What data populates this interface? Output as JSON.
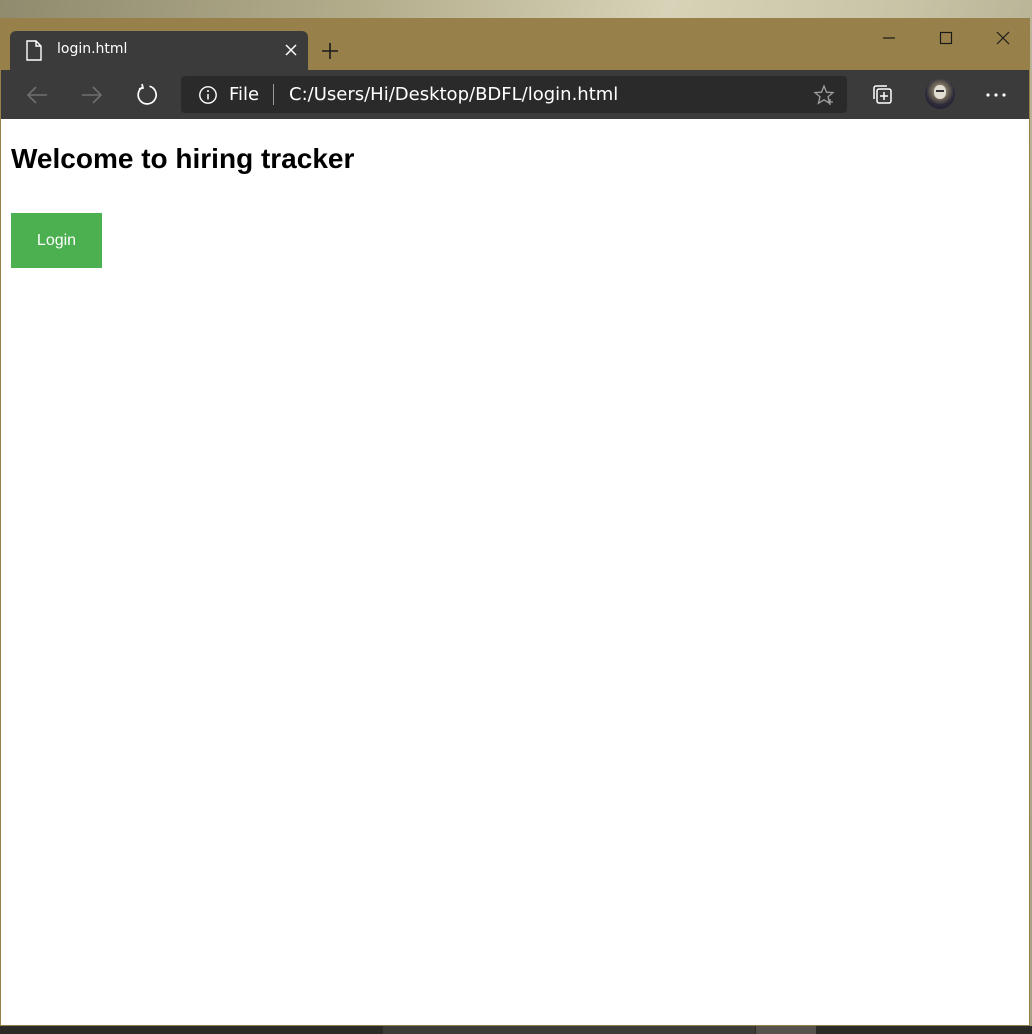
{
  "browser": {
    "tab": {
      "title": "login.html",
      "icon": "page-icon",
      "close_icon": "close-icon"
    },
    "new_tab_icon": "plus-icon",
    "window_controls": [
      "minimize-icon",
      "maximize-icon",
      "close-icon"
    ],
    "toolbar": {
      "back_icon": "back-arrow-icon",
      "forward_icon": "forward-arrow-icon",
      "refresh_icon": "refresh-icon",
      "collections_icon": "collections-icon",
      "more_icon": "more-icon"
    },
    "address_bar": {
      "info_icon": "info-icon",
      "scheme_label": "File",
      "url": "C:/Users/Hi/Desktop/BDFL/login.html",
      "favorite_icon": "star-icon"
    }
  },
  "page": {
    "heading": "Welcome to hiring tracker",
    "login_button_label": "Login"
  },
  "colors": {
    "title_bar": "#98804a",
    "toolbar": "#3b3b3b",
    "login_button": "#4caf50"
  }
}
